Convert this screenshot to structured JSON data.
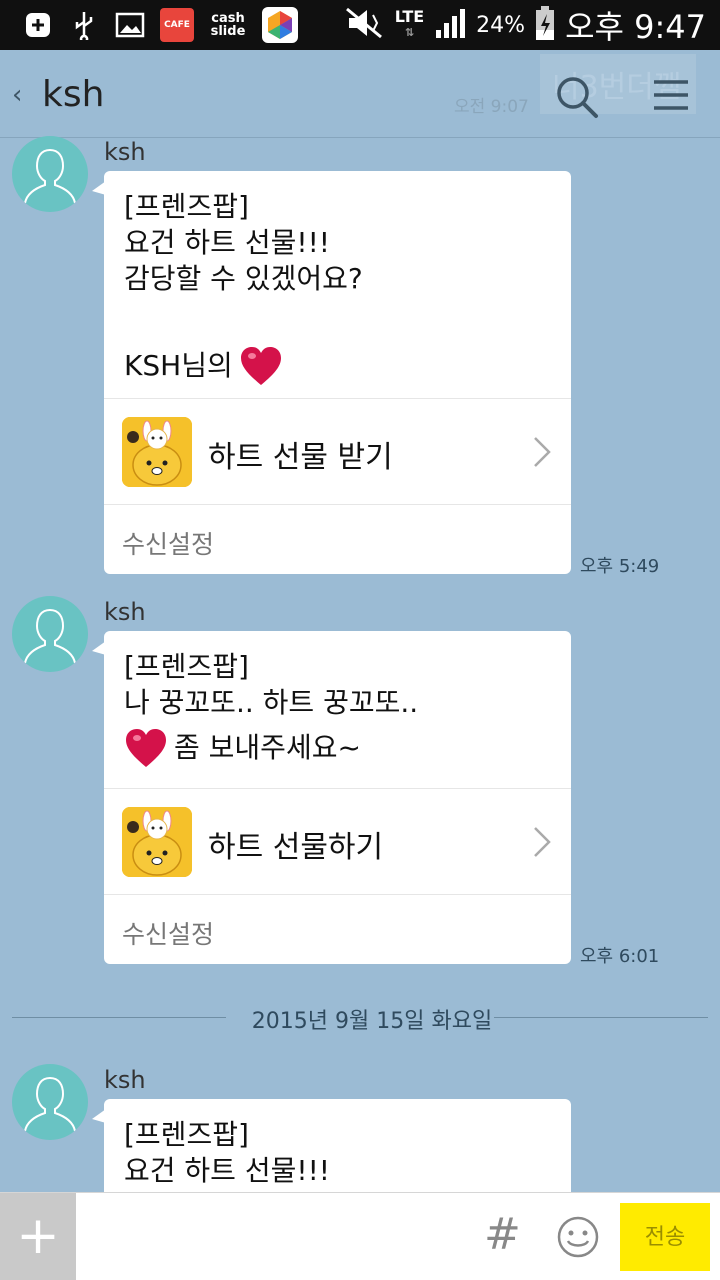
{
  "status_bar": {
    "cafe_badge": "CAFE",
    "cashslide": "cash slide",
    "network": "LTE",
    "battery": "24%",
    "time": "오후 9:47"
  },
  "header": {
    "back": "‹",
    "title": "ksh",
    "bg_preview": "너3번더깸",
    "bg_time": "오전 9:07"
  },
  "messages": [
    {
      "sender": "ksh",
      "lines": [
        "[프렌즈팝]",
        "요건 하트 선물!!!",
        "감당할 수 있겠어요?",
        "",
        "KSH님의"
      ],
      "action": "하트 선물 받기",
      "setting": "수신설정",
      "time": "오후 5:49"
    },
    {
      "sender": "ksh",
      "lines": [
        "[프렌즈팝]",
        "나 꿍꼬또.. 하트 꿍꼬또..",
        "좀 보내주세요~"
      ],
      "action": "하트 선물하기",
      "setting": "수신설정",
      "time": "오후 6:01"
    },
    {
      "sender": "ksh",
      "lines": [
        "[프렌즈팝]",
        "요건 하트 선물!!!"
      ]
    }
  ],
  "date_divider": "2015년 9월 15일 화요일",
  "input_bar": {
    "plus": "+",
    "placeholder": "",
    "hash": "#",
    "send": "전송"
  },
  "colors": {
    "chat_bg": "#9bbbd4",
    "send_button": "#ffeb00",
    "avatar": "#69c3c3",
    "heart": "#d4124a",
    "ryan": "#f5c12a"
  }
}
